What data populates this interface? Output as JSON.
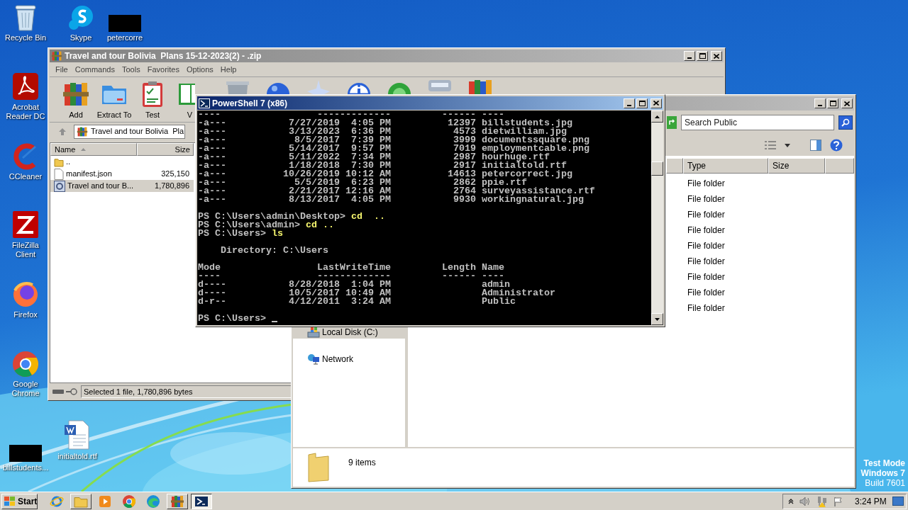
{
  "desktop_icons": [
    {
      "kind": "recycle",
      "label": "Recycle Bin"
    },
    {
      "kind": "chat",
      "label": "Skype"
    },
    {
      "kind": "redacted",
      "label": "petercorre"
    },
    {
      "kind": "pdf",
      "label": "Acrobat Reader DC"
    },
    {
      "kind": "cleaner",
      "label": "CCleaner"
    },
    {
      "kind": "ftp",
      "label": "FileZilla Client"
    },
    {
      "kind": "fox",
      "label": "Firefox"
    },
    {
      "kind": "wheel",
      "label": "Google Chrome"
    },
    {
      "kind": "redacted",
      "label": "billstudents..."
    },
    {
      "kind": "doc",
      "label": "initialtold.rtf"
    }
  ],
  "os_notice": [
    "Test Mode",
    "Windows 7",
    "Build 7601"
  ],
  "archive_window": {
    "title": "Travel and tour Bolivia  Plans 15-12-2023(2) - .zip",
    "menu": [
      "File",
      "Commands",
      "Tools",
      "Favorites",
      "Options",
      "Help"
    ],
    "toolbar": [
      {
        "kind": "add",
        "label": "Add"
      },
      {
        "kind": "extract",
        "label": "Extract To"
      },
      {
        "kind": "test",
        "label": "Test"
      },
      {
        "kind": "view",
        "label": "V"
      },
      {
        "kind": "delete"
      },
      {
        "kind": "find"
      },
      {
        "kind": "wizard"
      },
      {
        "kind": "info"
      },
      {
        "kind": "repair"
      },
      {
        "kind": "scan"
      },
      {
        "kind": "sfx"
      }
    ],
    "path": "Travel and tour Bolivia  Pla",
    "columns": [
      {
        "label": "Name",
        "sorted": true
      },
      {
        "label": "Size",
        "sorted": false
      }
    ],
    "rows": [
      {
        "kind": "parent",
        "name": "..",
        "selected": false
      },
      {
        "kind": "file",
        "name": "manifest.json",
        "size": "325,150",
        "selected": false
      },
      {
        "kind": "archive",
        "name": "Travel and tour B...",
        "size": "1,780,896",
        "selected": true
      }
    ],
    "status": "Selected 1 file, 1,780,896 bytes"
  },
  "explorer_window": {
    "search_placeholder": "Search Public",
    "columns": [
      "Type",
      "Size"
    ],
    "rows": [
      {
        "type": "File folder"
      },
      {
        "type": "File folder"
      },
      {
        "type": "File folder"
      },
      {
        "type": "File folder"
      },
      {
        "type": "File folder"
      },
      {
        "type": "File folder"
      },
      {
        "type": "File folder"
      },
      {
        "type": "File folder"
      },
      {
        "type": "File folder"
      }
    ],
    "nav": [
      {
        "kind": "disk",
        "label": "Local Disk (C:)",
        "selected": true
      },
      {
        "kind": "network",
        "label": "Network",
        "selected": false
      }
    ],
    "item_count": "9 items"
  },
  "console_window": {
    "title": "PowerShell 7 (x86)",
    "lines": [
      {
        "kind": "output",
        "text": "----                 -------------         ------ ----"
      },
      {
        "kind": "entry",
        "mode": "-a---",
        "date": "7/27/2019",
        "time": "4:05 PM",
        "length": "12397",
        "name": "billstudents.jpg"
      },
      {
        "kind": "entry",
        "mode": "-a---",
        "date": "3/13/2023",
        "time": "6:36 PM",
        "length": "4573",
        "name": "dietwilliam.jpg"
      },
      {
        "kind": "entry",
        "mode": "-a---",
        "date": "8/5/2017",
        "time": "7:39 PM",
        "length": "3999",
        "name": "documentssquare.png"
      },
      {
        "kind": "entry",
        "mode": "-a---",
        "date": "5/14/2017",
        "time": "9:57 PM",
        "length": "7019",
        "name": "employmentcable.png"
      },
      {
        "kind": "entry",
        "mode": "-a---",
        "date": "5/11/2022",
        "time": "7:34 PM",
        "length": "2987",
        "name": "hourhuge.rtf"
      },
      {
        "kind": "entry",
        "mode": "-a---",
        "date": "1/18/2018",
        "time": "7:30 PM",
        "length": "2917",
        "name": "initialtold.rtf"
      },
      {
        "kind": "entry",
        "mode": "-a---",
        "date": "10/26/2019",
        "time": "10:12 AM",
        "length": "14613",
        "name": "petercorrect.jpg"
      },
      {
        "kind": "entry",
        "mode": "-a---",
        "date": "5/5/2019",
        "time": "6:23 PM",
        "length": "2862",
        "name": "ppie.rtf"
      },
      {
        "kind": "entry",
        "mode": "-a---",
        "date": "2/21/2017",
        "time": "12:16 AM",
        "length": "2764",
        "name": "surveyassistance.rtf"
      },
      {
        "kind": "entry",
        "mode": "-a---",
        "date": "8/13/2017",
        "time": "4:05 PM",
        "length": "9930",
        "name": "workingnatural.jpg"
      },
      {
        "kind": "blank"
      },
      {
        "kind": "prompt",
        "prompt": "PS C:\\Users\\admin\\Desktop> ",
        "command": "cd  ..",
        "cursor": false
      },
      {
        "kind": "prompt",
        "prompt": "PS C:\\Users\\admin> ",
        "command": "cd ..",
        "cursor": false
      },
      {
        "kind": "prompt",
        "prompt": "PS C:\\Users> ",
        "command": "ls",
        "cursor": false
      },
      {
        "kind": "blank"
      },
      {
        "kind": "output",
        "text": "    Directory: C:\\Users"
      },
      {
        "kind": "blank"
      },
      {
        "kind": "output",
        "text": "Mode                 LastWriteTime         Length Name"
      },
      {
        "kind": "output",
        "text": "----                 -------------         ------ ----"
      },
      {
        "kind": "entry",
        "mode": "d----",
        "date": "8/28/2018",
        "time": "1:04 PM",
        "name": "admin"
      },
      {
        "kind": "entry",
        "mode": "d----",
        "date": "10/5/2017",
        "time": "10:49 AM",
        "name": "Administrator"
      },
      {
        "kind": "entry",
        "mode": "d-r--",
        "date": "4/12/2011",
        "time": "3:24 AM",
        "name": "Public"
      },
      {
        "kind": "blank"
      },
      {
        "kind": "prompt",
        "prompt": "PS C:\\Users> ",
        "cursor": true
      }
    ]
  },
  "taskbar": {
    "start": "Start",
    "apps": [
      {
        "kind": "ie",
        "open": false,
        "selected": false
      },
      {
        "kind": "explorer",
        "open": true,
        "selected": false
      },
      {
        "kind": "media",
        "open": false,
        "selected": false
      },
      {
        "kind": "chrome",
        "open": false,
        "selected": false
      },
      {
        "kind": "edge",
        "open": false,
        "selected": false
      },
      {
        "kind": "winrar",
        "open": true,
        "selected": false
      },
      {
        "kind": "terminal",
        "open": true,
        "selected": true
      }
    ],
    "clock": "3:24 PM"
  }
}
